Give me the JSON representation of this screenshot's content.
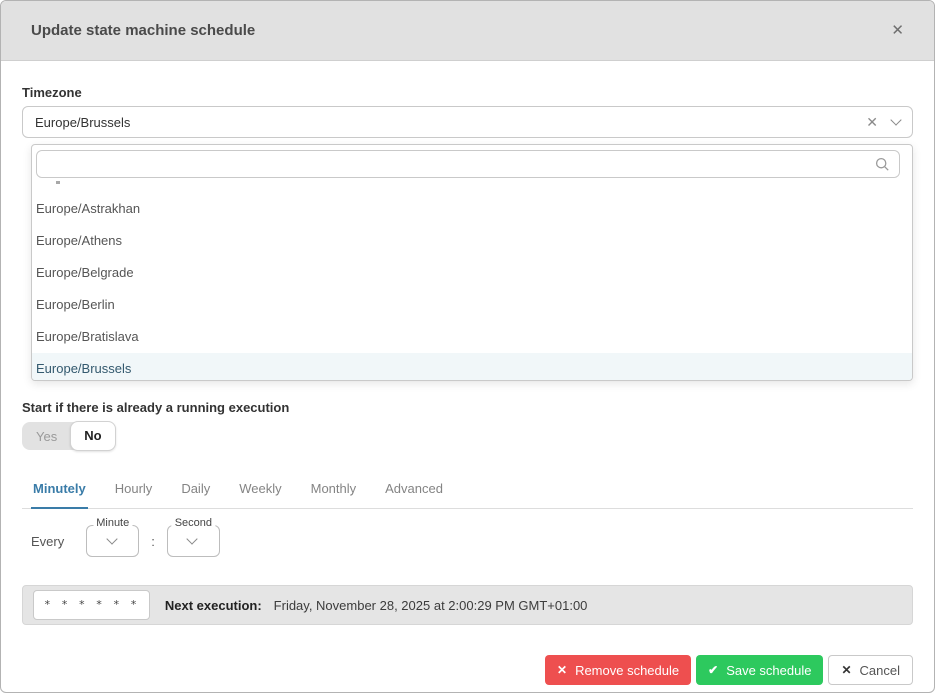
{
  "header": {
    "title": "Update state machine schedule",
    "close_icon": "✕"
  },
  "timezone": {
    "label": "Timezone",
    "value": "Europe/Brussels",
    "clear_icon": "✕",
    "search": {
      "value": "",
      "placeholder": ""
    },
    "options": [
      {
        "label": "Europe/Astrakhan"
      },
      {
        "label": "Europe/Athens"
      },
      {
        "label": "Europe/Belgrade"
      },
      {
        "label": "Europe/Berlin"
      },
      {
        "label": "Europe/Bratislava"
      },
      {
        "label": "Europe/Brussels"
      }
    ],
    "selected_option": "Europe/Brussels"
  },
  "running_execution": {
    "label": "Start if there is already a running execution",
    "options": [
      "Yes",
      "No"
    ],
    "selected": "No"
  },
  "tabs": {
    "items": [
      "Minutely",
      "Hourly",
      "Daily",
      "Weekly",
      "Monthly",
      "Advanced"
    ],
    "active": "Minutely"
  },
  "schedule": {
    "every_label": "Every",
    "minute_label": "Minute",
    "second_label": "Second",
    "separator": ":"
  },
  "summary": {
    "cron_expression": "* * * * * *",
    "next_execution_label": "Next execution:",
    "next_execution_value": "Friday, November 28, 2025 at 2:00:29 PM GMT+01:00"
  },
  "footer": {
    "remove_icon": "✕",
    "remove_label": "Remove schedule",
    "save_icon": "✔",
    "save_label": "Save schedule",
    "cancel_icon": "✕",
    "cancel_label": "Cancel"
  },
  "colors": {
    "accent_blue": "#3a7ca8",
    "danger_red": "#ee4f4f",
    "success_green": "#2dc95e",
    "selected_option_bg": "#f1f7f9",
    "selected_option_text": "#33596e",
    "header_bg": "#e1e1e1",
    "summary_bar_bg": "#e5e5e5"
  }
}
